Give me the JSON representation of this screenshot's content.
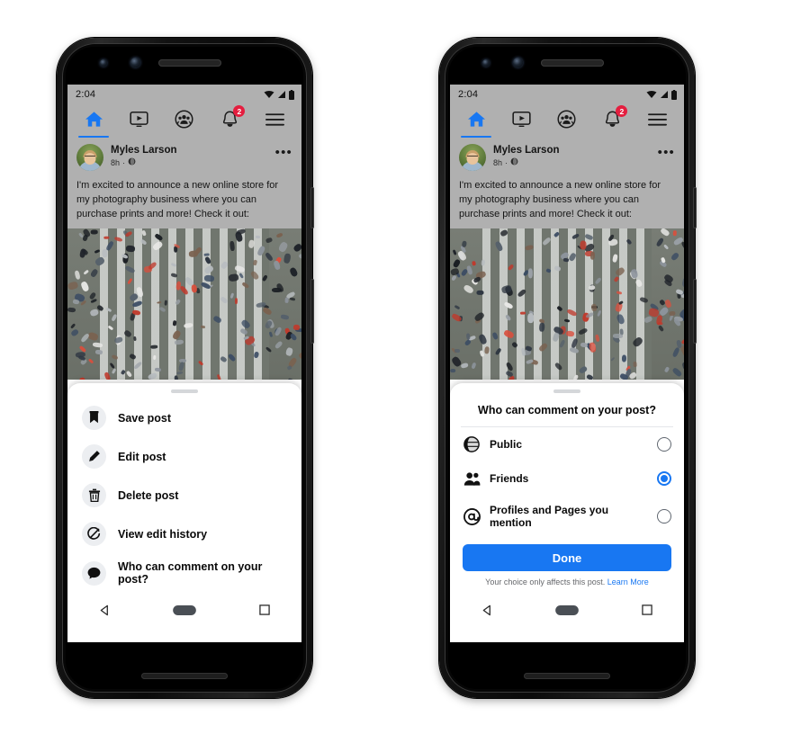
{
  "status_bar": {
    "time": "2:04",
    "wifi_icon": "wifi-icon",
    "signal_icon": "signal-icon",
    "battery_icon": "battery-icon"
  },
  "nav": {
    "items": [
      {
        "name": "home",
        "icon": "home-icon",
        "active": true,
        "badge": ""
      },
      {
        "name": "video",
        "icon": "video-icon",
        "active": false,
        "badge": ""
      },
      {
        "name": "groups",
        "icon": "groups-icon",
        "active": false,
        "badge": ""
      },
      {
        "name": "notifications",
        "icon": "bell-icon",
        "active": false,
        "badge": "2"
      },
      {
        "name": "menu",
        "icon": "hamburger-menu-icon",
        "active": false,
        "badge": ""
      }
    ]
  },
  "post": {
    "author": "Myles Larson",
    "time": "8h",
    "separator": "·",
    "audience_icon": "globe-icon",
    "more_icon": "•••",
    "body": "I'm excited to announce a new online store for my photography business where you can purchase prints and more! Check it out:",
    "image_alt": "aerial-photo-of-crosswalk-with-pedestrians"
  },
  "left_phone": {
    "sheet_title": "",
    "menu_items": [
      {
        "label": "Save post",
        "icon": "bookmark-icon"
      },
      {
        "label": "Edit post",
        "icon": "pencil-icon"
      },
      {
        "label": "Delete post",
        "icon": "trash-icon"
      },
      {
        "label": "View edit history",
        "icon": "history-icon"
      },
      {
        "label": "Who can comment on your post?",
        "icon": "comment-icon"
      }
    ]
  },
  "right_phone": {
    "dialog_title": "Who can comment on your post?",
    "options": [
      {
        "label": "Public",
        "icon": "globe-icon",
        "selected": false
      },
      {
        "label": "Friends",
        "icon": "friends-icon",
        "selected": true
      },
      {
        "label": "Profiles and Pages you mention",
        "icon": "at-mention-icon",
        "selected": false
      }
    ],
    "done_label": "Done",
    "footer_text": "Your choice only affects this post.",
    "footer_link": "Learn More"
  },
  "android_nav": {
    "back_icon": "back-triangle-icon",
    "home_icon": "home-pill-icon",
    "recents_icon": "recents-square-icon"
  },
  "colors": {
    "accent": "#1877F2",
    "badge": "#E41E3F",
    "sheet_bg": "#FFFFFF",
    "chrome_bg": "#B0B0B0",
    "link": "#1877F2"
  }
}
